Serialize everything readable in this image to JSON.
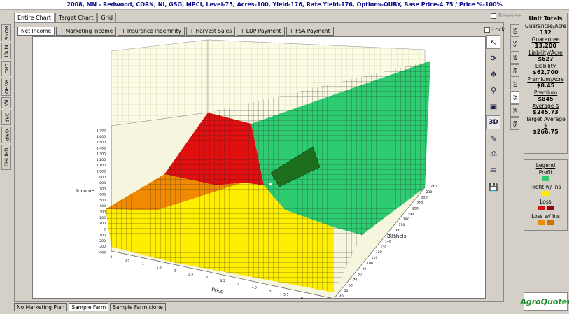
{
  "title": "2008, MN - Redwood, CORN, NI, GSG, MPCI, Level-75, Acres-100, Yield-176, Rate Yield-176, Options-OUBY, Base Price-4.75 / Price %-100%",
  "top_tabs": [
    "Entire Chart",
    "Target Chart",
    "Grid"
  ],
  "reverse_label": "Reverse",
  "left_tabs": [
    "NONE",
    "MPCI",
    "CRC",
    "RAHO",
    "RA",
    "GRP",
    "GRIP",
    "GRIPHO"
  ],
  "sub_tabs": [
    "Net Income",
    "+ Marketing Income",
    "+ Insurance Indemnity",
    "+ Harvest Sales",
    "+ LDP Payment",
    "+ FSA Payment"
  ],
  "lock_label": "Lock",
  "tool_3d_label": "3D",
  "right_tabs": [
    "50",
    "55",
    "60",
    "65",
    "70",
    "75",
    "80",
    "85"
  ],
  "units": {
    "heading": "Unit Totals",
    "items": [
      {
        "label": "Guarantee/Acre",
        "value": "132"
      },
      {
        "label": "Guarantee",
        "value": "13,200"
      },
      {
        "label": "Liability/Acre",
        "value": "$627"
      },
      {
        "label": "Liability",
        "value": "$62,700"
      },
      {
        "label": "Premium/Acre",
        "value": "$8.45"
      },
      {
        "label": "Premium",
        "value": "$845"
      },
      {
        "label": "Average $",
        "value": "$245.73"
      },
      {
        "label": "Target Average $",
        "value": "$266.75"
      }
    ]
  },
  "legend": {
    "heading": "Legend",
    "items": [
      {
        "label": "Profit",
        "colors": [
          "#2ecc71"
        ]
      },
      {
        "label": "Profit w/ Ins",
        "colors": [
          "#ffee00"
        ]
      },
      {
        "label": "Loss",
        "colors": [
          "#e01010",
          "#8a0c0c"
        ]
      },
      {
        "label": "Loss w/ Ins",
        "colors": [
          "#f08a00",
          "#d07000"
        ]
      }
    ]
  },
  "logo_text": "AgroQuoter",
  "bottom_tabs": [
    "No Marketing Plan",
    "Sample Farm",
    "Sample Farm clone"
  ],
  "chart_data": {
    "type": "surface",
    "zlabel": "Income",
    "xlabel": "Price",
    "ylabel": "Bushels",
    "z_ticks": [
      "1,700",
      "1,600",
      "1,500",
      "1,400",
      "1,300",
      "1,200",
      "1,100",
      "1,000",
      "900",
      "800",
      "700",
      "600",
      "500",
      "400",
      "300",
      "200",
      "100",
      "0",
      "-100",
      "-200",
      "-300",
      "-400"
    ],
    "x_ticks": [
      "0",
      "0.5",
      "1",
      "1.5",
      "2",
      "2.5",
      "3",
      "3.5",
      "4",
      "4.5",
      "5",
      "5.5",
      "6",
      "6.5"
    ],
    "y_ticks": [
      "40",
      "50",
      "60",
      "70",
      "80",
      "90",
      "100",
      "110",
      "120",
      "130",
      "140",
      "150",
      "160",
      "170",
      "180",
      "190",
      "200",
      "210",
      "220",
      "230",
      "240"
    ],
    "regions": [
      "Loss",
      "Loss w/ Ins",
      "Profit w/ Ins",
      "Profit"
    ],
    "region_colors": {
      "profit": "#2ecc71",
      "profit_ins": "#ffee00",
      "loss": "#e01010",
      "loss_ins": "#f08a00"
    }
  }
}
